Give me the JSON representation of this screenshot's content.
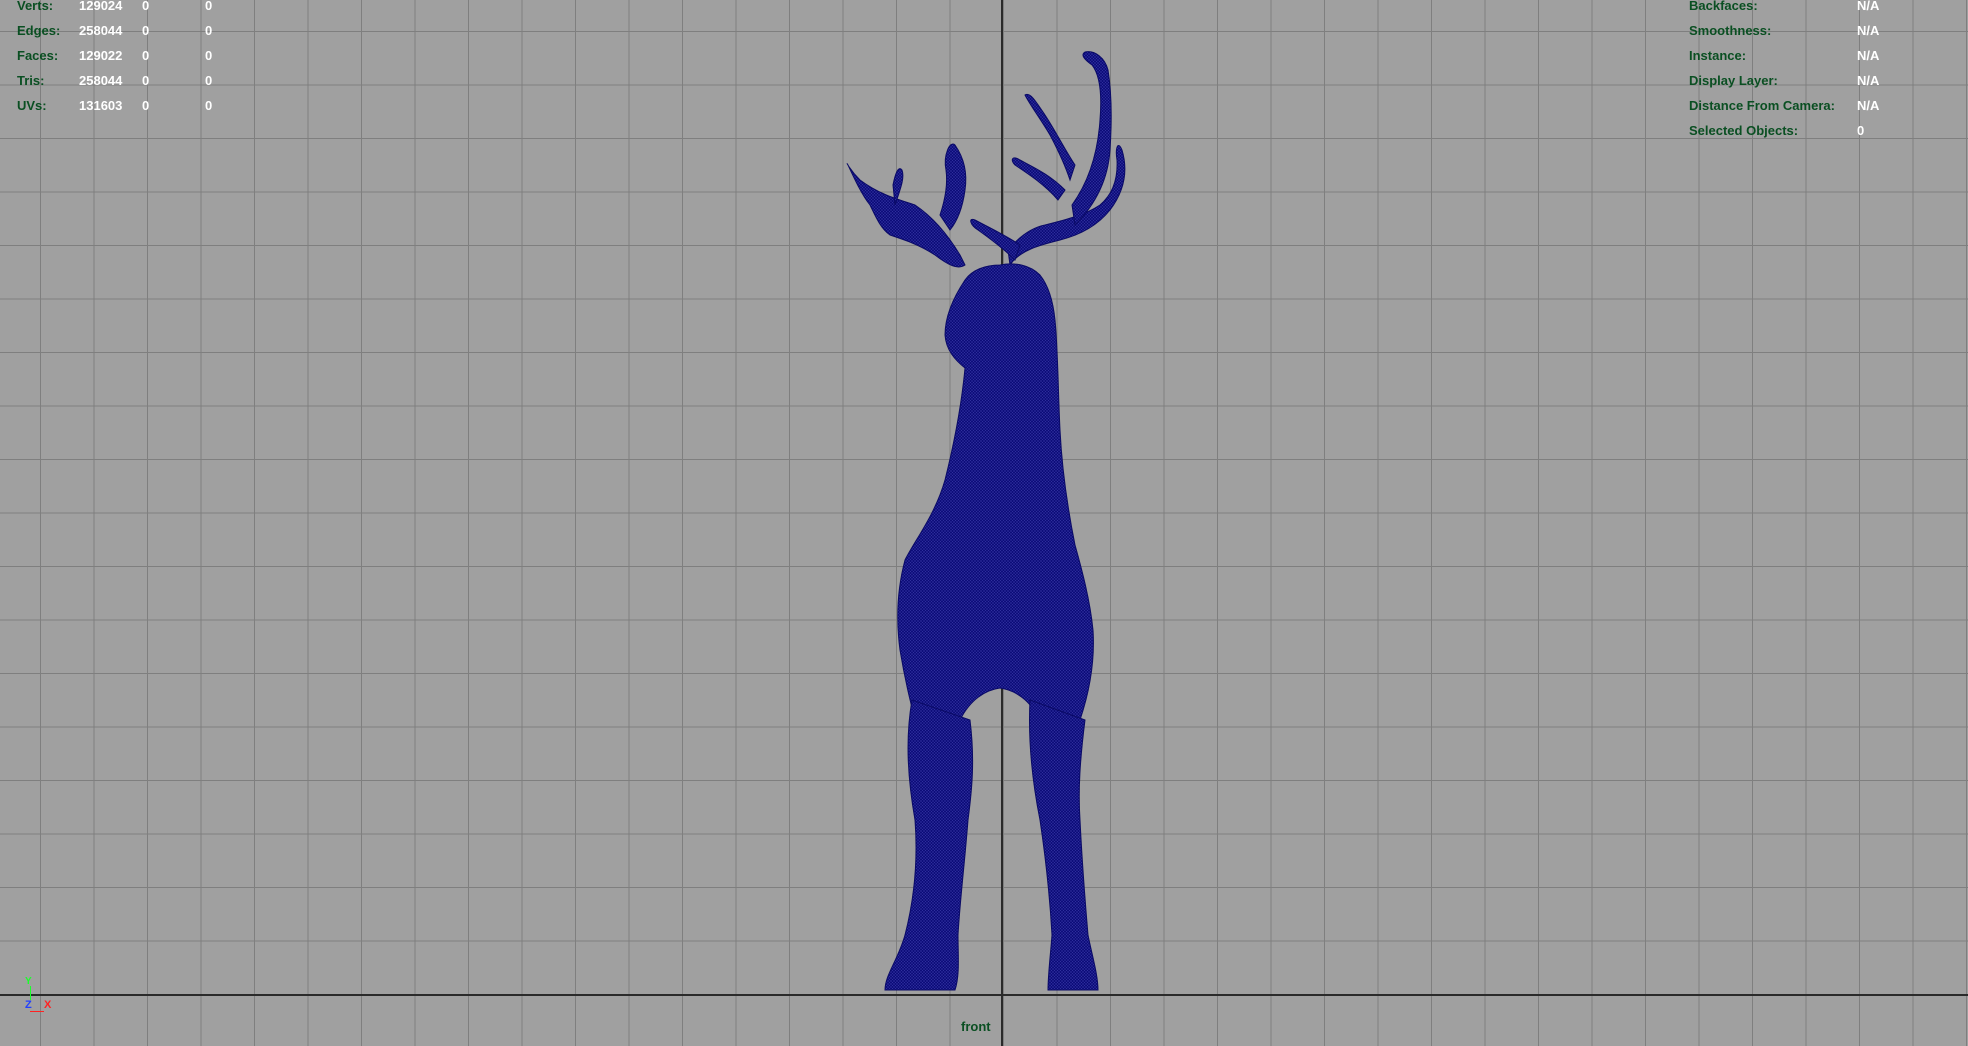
{
  "viewport": {
    "camera": "front",
    "background_color": "#a0a0a0",
    "grid_color": "#7f7f7f",
    "mesh_color": "#0d0d7a"
  },
  "hud_left": {
    "rows": [
      {
        "label": "Verts:",
        "v1": "129024",
        "v2": "0",
        "v3": "0"
      },
      {
        "label": "Edges:",
        "v1": "258044",
        "v2": "0",
        "v3": "0"
      },
      {
        "label": "Faces:",
        "v1": "129022",
        "v2": "0",
        "v3": "0"
      },
      {
        "label": "Tris:",
        "v1": "258044",
        "v2": "0",
        "v3": "0"
      },
      {
        "label": "UVs:",
        "v1": "131603",
        "v2": "0",
        "v3": "0"
      }
    ]
  },
  "hud_right": {
    "rows": [
      {
        "label": "Backfaces:",
        "value": "N/A"
      },
      {
        "label": "Smoothness:",
        "value": "N/A"
      },
      {
        "label": "Instance:",
        "value": "N/A"
      },
      {
        "label": "Display Layer:",
        "value": "N/A"
      },
      {
        "label": "Distance From Camera:",
        "value": "N/A"
      },
      {
        "label": "Selected Objects:",
        "value": "0"
      }
    ]
  },
  "axis_gizmo": {
    "y": "Y",
    "z": "Z",
    "x": "X"
  }
}
